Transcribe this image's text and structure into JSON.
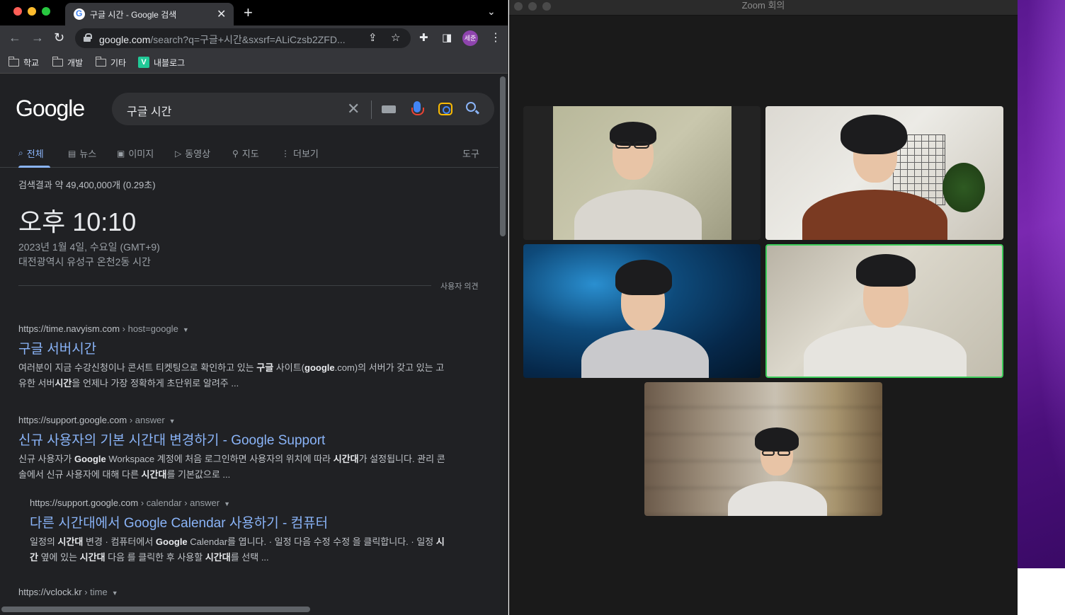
{
  "browser": {
    "tab_title": "구글 시간 - Google 검색",
    "url_host": "google.com",
    "url_rest": "/search?q=구글+시간&sxsrf=ALiCzsb2ZFD...",
    "profile_label": "세준",
    "bookmarks": [
      "학교",
      "개발",
      "기타",
      "내블로그"
    ],
    "bookmark_vlog_glyph": "V"
  },
  "google": {
    "logo": "Google",
    "query": "구글 시간",
    "tabs": [
      "전체",
      "뉴스",
      "이미지",
      "동영상",
      "지도",
      "더보기"
    ],
    "tools": "도구",
    "stats": "검색결과 약 49,400,000개 (0.29초)",
    "time": "오후 10:10",
    "date": "2023년 1월 4일, 수요일 (GMT+9)",
    "location": "대전광역시 유성구 온천2동 시간",
    "feedback": "사용자 의견",
    "results": [
      {
        "cite_host": "https://time.navyism.com",
        "cite_path": " › host=google",
        "title": "구글 서버시간",
        "snippet_html": "여러분이 지금 수강신청이나 콘서트 티켓팅으로 확인하고 있는 <b>구글</b> 사이트(<b>google</b>.com)의 서버가 갖고 있는 고유한 서버<b>시간</b>을 언제나 가장 정확하게 초단위로 알려주 ..."
      },
      {
        "cite_host": "https://support.google.com",
        "cite_path": " › answer",
        "title": "신규 사용자의 기본 시간대 변경하기 - Google Support",
        "snippet_html": "신규 사용자가 <b>Google</b> Workspace 계정에 처음 로그인하면 사용자의 위치에 따라 <b>시간대</b>가 설정됩니다. 관리 콘솔에서 신규 사용자에 대해 다른 <b>시간대</b>를 기본값으로 ..."
      },
      {
        "cite_host": "https://support.google.com",
        "cite_path": " › calendar › answer",
        "title": "다른 시간대에서 Google Calendar 사용하기 - 컴퓨터",
        "snippet_html": "일정의 <b>시간대</b> 변경 · 컴퓨터에서 <b>Google</b> Calendar를 엽니다. · 일정 다음 수정 수정 을 클릭합니다. · 일정 <b>시간</b> 옆에 있는 <b>시간대</b> 다음 를 클릭한 후 사용할 <b>시간대</b>를 선택 ..."
      },
      {
        "cite_host": "https://vclock.kr",
        "cite_path": " › time"
      }
    ]
  },
  "zoom": {
    "title": "Zoom 회의"
  }
}
